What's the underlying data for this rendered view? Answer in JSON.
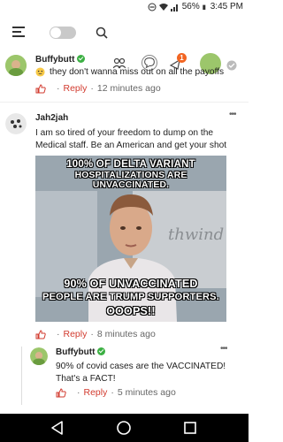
{
  "status": {
    "battery": "56%",
    "time": "3:45 PM"
  },
  "notifications": {
    "count": "1"
  },
  "comments": [
    {
      "username": "Buffybutt",
      "text": "they don't wanna miss out on all the payoffs",
      "reply_label": "Reply",
      "time": "12 minutes ago"
    },
    {
      "username": "Jah2jah",
      "text": "I am so tired of your freedom to dump on the Medical staff. Be an American and get your shot",
      "meme": {
        "top_line1": "100% OF DELTA VARIANT",
        "top_line2": "HOSPITALIZATIONS ARE UNVACCINATED.",
        "bottom_line1": "90% OF UNVACCINATED",
        "bottom_line2": "PEOPLE ARE TRUMP SUPPORTERS.",
        "bottom_line3": "OOOPS!!"
      },
      "reply_label": "Reply",
      "time": "8 minutes ago"
    },
    {
      "username": "Buffybutt",
      "text": "90% of covid cases are the VACCINATED! That's a FACT!",
      "reply_label": "Reply",
      "time": "5 minutes ago"
    }
  ],
  "colors": {
    "reply": "#d23b2f",
    "verified": "#3cb043",
    "notification_badge": "#f26522"
  }
}
